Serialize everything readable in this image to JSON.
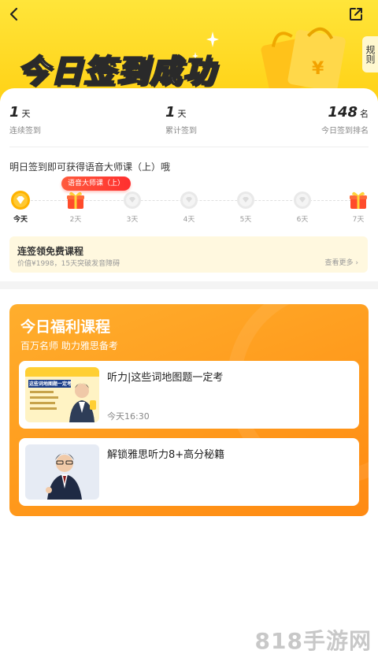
{
  "header": {
    "headline": "今日签到成功",
    "rules_label": "规则"
  },
  "stats": [
    {
      "value": "1",
      "unit": "天",
      "label": "连续签到"
    },
    {
      "value": "1",
      "unit": "天",
      "label": "累计签到"
    },
    {
      "value": "148",
      "unit": "名",
      "label": "今日签到排名"
    }
  ],
  "tomorrow_text": "明日签到即可获得语音大师课（上）哦",
  "tip_label": "语音大师课（上）",
  "days": [
    {
      "label": "今天",
      "icon": "diamond-coin-icon"
    },
    {
      "label": "2天",
      "icon": "gift-icon"
    },
    {
      "label": "3天",
      "icon": "coin-icon"
    },
    {
      "label": "4天",
      "icon": "coin-icon"
    },
    {
      "label": "5天",
      "icon": "coin-icon"
    },
    {
      "label": "6天",
      "icon": "coin-icon"
    },
    {
      "label": "7天",
      "icon": "gift-icon"
    }
  ],
  "promo": {
    "title": "连签领免费课程",
    "subtitle": "价值¥1998，15天突破发音障碍",
    "more": "查看更多"
  },
  "welfare": {
    "title": "今日福利课程",
    "subtitle": "百万名师 助力雅思备考",
    "courses": [
      {
        "title": "听力|这些词地图题一定考",
        "meta": "今天16:30",
        "thumb_text": "这些词地图题一定考"
      },
      {
        "title": "解锁雅思听力8+高分秘籍",
        "meta": ""
      }
    ]
  },
  "watermark": "818手游网",
  "colors": {
    "header_yellow": "#ffd51c",
    "welfare_orange": "#ff9a1c",
    "tip_red": "#ff3a30",
    "promo_bg": "#fff8df"
  }
}
